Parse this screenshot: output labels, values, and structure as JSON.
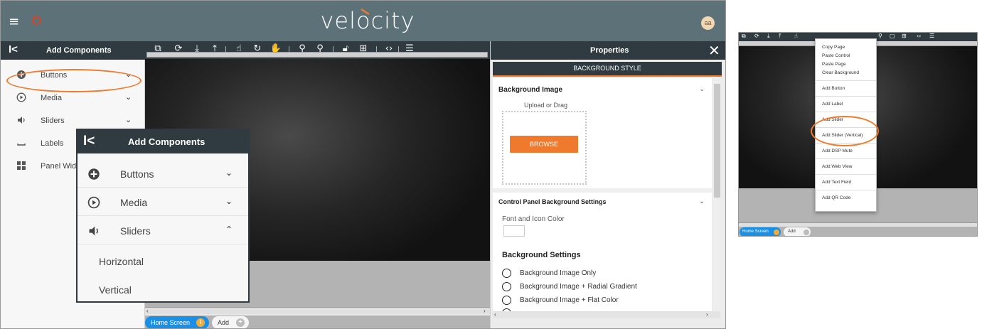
{
  "app": {
    "logo_text": "velocity",
    "avatar_initials": "aa",
    "hamburger_icon": "≡",
    "power_icon": "⏻"
  },
  "left_panel": {
    "collapse_glyph": "I<",
    "title": "Add Components",
    "items": [
      {
        "label": "Buttons",
        "icon": "plus-circle-icon"
      },
      {
        "label": "Media",
        "icon": "play-circle-icon"
      },
      {
        "label": "Sliders",
        "icon": "speaker-icon"
      },
      {
        "label": "Labels",
        "icon": "label-icon"
      },
      {
        "label": "Panel Widg",
        "icon": "widgets-icon"
      }
    ]
  },
  "zoom_popup": {
    "collapse_glyph": "I<",
    "title": "Add Components",
    "items": [
      {
        "label": "Buttons"
      },
      {
        "label": "Media"
      },
      {
        "label": "Sliders"
      }
    ],
    "sub_items": [
      "Horizontal",
      "Vertical"
    ]
  },
  "canvas_tabs": {
    "home": "Home Screen",
    "add": "Add"
  },
  "properties": {
    "title": "Properties",
    "close_glyph": "✕",
    "section_tab": "BACKGROUND STYLE",
    "background_image_label": "Background Image",
    "upload_label": "Upload or Drag",
    "browse_label": "BROWSE",
    "control_panel_label": "Control Panel Background Settings",
    "font_icon_color_label": "Font and Icon Color",
    "background_settings_label": "Background Settings",
    "radio_options": [
      "Background Image Only",
      "Background Image + Radial Gradient",
      "Background Image + Flat Color"
    ]
  },
  "mini": {
    "home_tab": "Home Screen",
    "add_tab": "Add",
    "context_menu": [
      "Copy Page",
      "Paste Control",
      "Paste Page",
      "Clear Background",
      "Add Button",
      "Add Label",
      "Add Slider",
      "Add Slider (Vertical)",
      "Add DSP Mute",
      "Add Web View",
      "Add Text Field",
      "Add QR Code"
    ]
  },
  "colors": {
    "topbar": "#5d7179",
    "header_dark": "#2f3b41",
    "accent_orange": "#ef7a2e",
    "tab_blue": "#1a8fe6"
  }
}
